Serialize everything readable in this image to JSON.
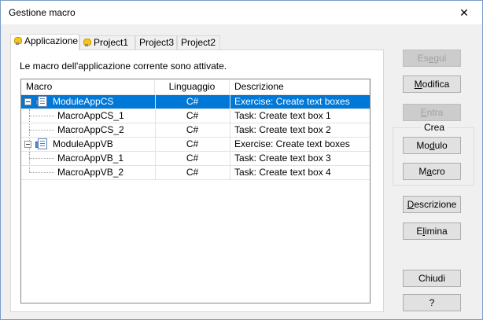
{
  "window": {
    "title": "Gestione macro",
    "close_glyph": "✕"
  },
  "tabs": [
    {
      "label": "Applicazione",
      "icon": "bulb-icon"
    },
    {
      "label": "Project1",
      "icon": "bulb-icon"
    },
    {
      "label": "Project3"
    },
    {
      "label": "Project2"
    }
  ],
  "intro": "Le macro dell'applicazione corrente sono attivate.",
  "list": {
    "columns": [
      "Macro",
      "Linguaggio",
      "Descrizione"
    ],
    "rows": [
      {
        "name": "ModuleAppCS",
        "language": "C#",
        "description": "Exercise: Create text boxes",
        "type": "module",
        "selected": true
      },
      {
        "name": "MacroAppCS_1",
        "language": "C#",
        "description": "Task: Create text box 1",
        "type": "macro"
      },
      {
        "name": "MacroAppCS_2",
        "language": "C#",
        "description": "Task: Create text box 2",
        "type": "macro"
      },
      {
        "name": "ModuleAppVB",
        "language": "C#",
        "description": "Exercise: Create text boxes",
        "type": "module"
      },
      {
        "name": "MacroAppVB_1",
        "language": "C#",
        "description": "Task: Create text box 3",
        "type": "macro"
      },
      {
        "name": "MacroAppVB_2",
        "language": "C#",
        "description": "Task: Create text box 4",
        "type": "macro"
      }
    ]
  },
  "buttons": {
    "run": {
      "pre": "Es",
      "accel": "e",
      "post": "gui"
    },
    "edit": {
      "pre": "",
      "accel": "M",
      "post": "odifica"
    },
    "step_into": {
      "pre": "",
      "accel": "E",
      "post": "ntra"
    },
    "create_group": "Crea",
    "module": {
      "pre": "Mo",
      "accel": "d",
      "post": "ulo"
    },
    "macro": {
      "pre": "M",
      "accel": "a",
      "post": "cro"
    },
    "description": {
      "pre": "",
      "accel": "D",
      "post": "escrizione"
    },
    "delete": {
      "pre": "E",
      "accel": "l",
      "post": "imina"
    },
    "close": "Chiudi",
    "help": "?"
  }
}
